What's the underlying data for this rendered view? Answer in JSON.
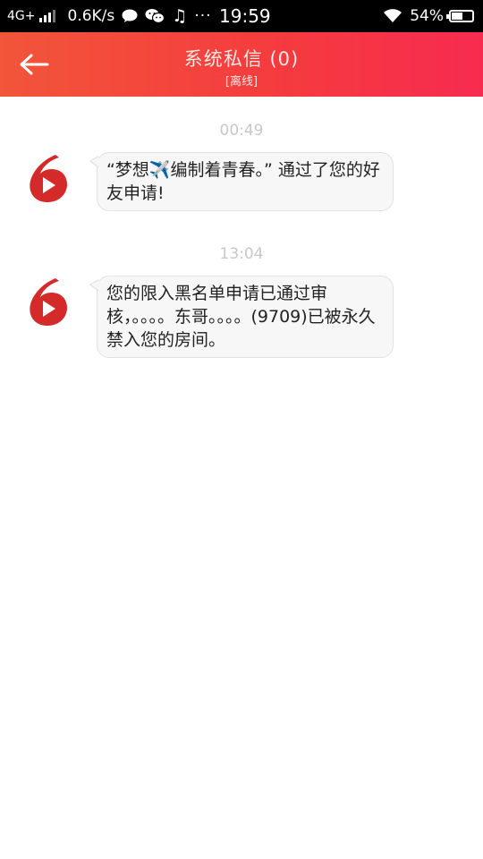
{
  "status_bar": {
    "network": "4G+",
    "speed": "0.6K/s",
    "music_glyph": "♫",
    "more_glyph": "···",
    "time": "19:59",
    "battery": "54%",
    "icons": [
      "signal-icon",
      "chat-icon",
      "wechat-icon",
      "music-icon",
      "more-dots-icon",
      "wifi-icon",
      "battery-icon"
    ]
  },
  "header": {
    "title": "系统私信 (0)",
    "status": "[离线]",
    "back_icon": "back-arrow-icon",
    "background_start": "#f2553a",
    "background_end": "#f72b50"
  },
  "messages": [
    {
      "time": "00:49",
      "text": "“梦想✈️编制着青春。” 通过了您的好友申请!",
      "avatar_icon": "six-logo-icon"
    },
    {
      "time": "13:04",
      "text": "您的限入黑名单申请已通过审核，。。。。东哥。。。。(9709)已被永久禁入您的房间。",
      "avatar_icon": "six-logo-icon"
    }
  ],
  "colors": {
    "logo_red": "#d42a2a",
    "timestamp": "#c8c8c8",
    "bubble_bg": "#f7f7f7"
  }
}
